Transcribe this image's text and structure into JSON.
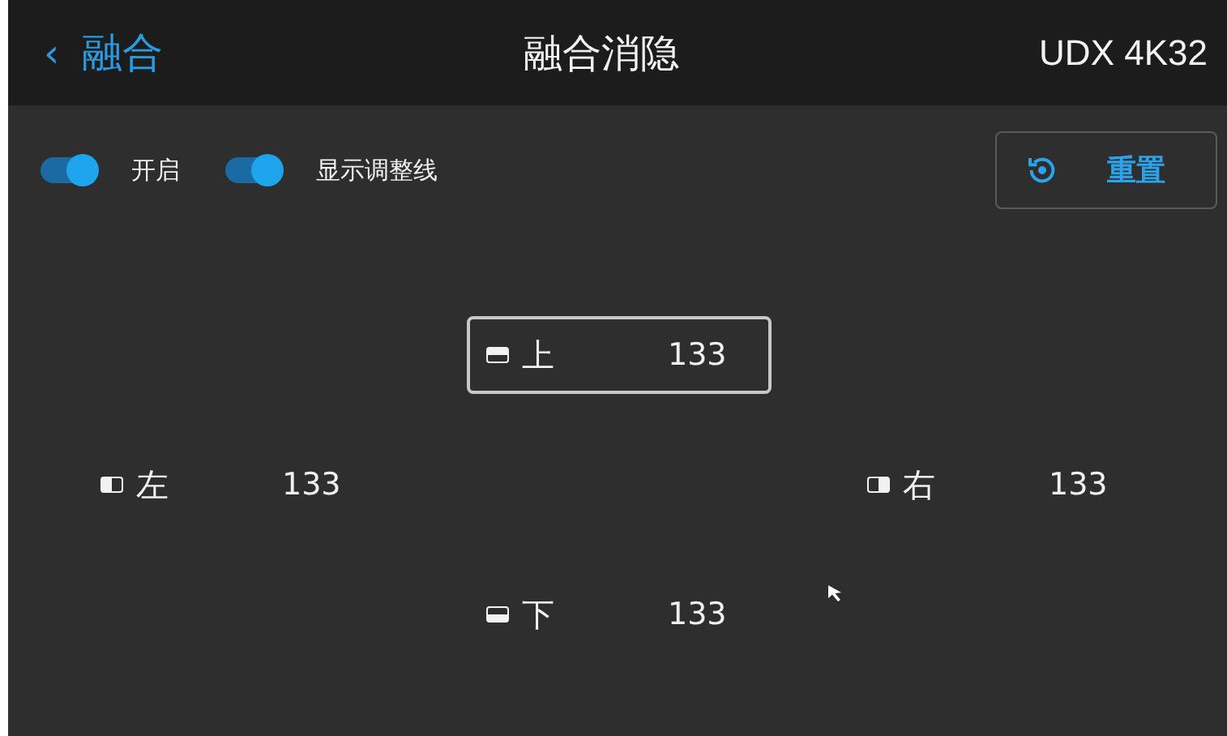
{
  "header": {
    "back_label": "融合",
    "back_glyph": "‹",
    "title": "融合消隐",
    "device": "UDX 4K32"
  },
  "toggles": [
    {
      "label": "开启",
      "on": true
    },
    {
      "label": "显示调整线",
      "on": true
    }
  ],
  "reset_button": {
    "label": "重置"
  },
  "edges": [
    {
      "kind": "top",
      "label": "上",
      "value": "133",
      "selected": true
    },
    {
      "kind": "left",
      "label": "左",
      "value": "133",
      "selected": false
    },
    {
      "kind": "right",
      "label": "右",
      "value": "133",
      "selected": false
    },
    {
      "kind": "bottom",
      "label": "下",
      "value": "133",
      "selected": false
    }
  ]
}
